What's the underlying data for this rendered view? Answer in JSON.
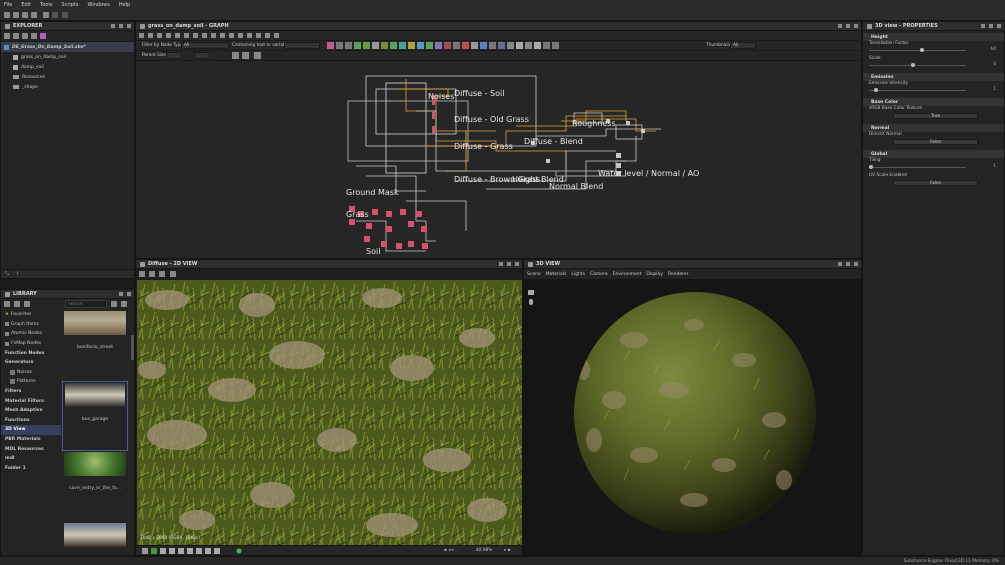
{
  "menu": [
    "File",
    "Edit",
    "Tools",
    "Scripts",
    "Windows",
    "Help"
  ],
  "explorer": {
    "title": "EXPLORER",
    "package": "DE_Grass_On_Damp_Soil.sbs*",
    "items": [
      "grass_on_damp_soil",
      "damp_soil",
      "Resources",
      "_shape"
    ]
  },
  "graph": {
    "title": "grass_on_damp_soil - GRAPH",
    "filter_label": "Filter by Node Type:",
    "filter_value": "All",
    "containing_label": "Containing text or variable:",
    "thumbnails_label": "Thumbnails:",
    "thumbnails_value": "All",
    "parent_size_label": "Parent Size:",
    "frames": [
      "Diffuse - Soil",
      "Noises",
      "Diffuse - Old Grass",
      "Roughness",
      "Diffuse - Grass",
      "Diffuse - Blend",
      "Diffuse - Brown Grass",
      "Height Blend",
      "Normal Blend",
      "Water level / Normal / AO",
      "Ground Mask",
      "Grass",
      "Soil"
    ]
  },
  "properties": {
    "title": "3D view - PROPERTIES",
    "sections": {
      "height": "Height",
      "emission": "Emission",
      "base_color": "Base Color",
      "normal": "Normal",
      "global": "Global"
    },
    "tessellation_label": "Tessellation Factor",
    "tessellation_value": "64",
    "scale_label": "Scale",
    "scale_value": "4",
    "emissive_label": "Emissive Intensity",
    "emissive_value": "1",
    "srgb_label": "sRGB Base Color Texture",
    "srgb_value": "True",
    "directx_label": "DirectX Normal",
    "directx_value": "False",
    "tiling_label": "Tiling",
    "tiling_value": "1",
    "uvscale_label": "UV Scale Enabled",
    "uvscale_value": "False"
  },
  "library": {
    "title": "LIBRARY",
    "search_placeholder": "Search",
    "categories": [
      "Favorites",
      "Graph Items",
      "Atomic Nodes",
      "FxMap Nodes",
      "Function Nodes",
      "Generators",
      "Noises",
      "Patterns",
      "Filters",
      "Material Filters",
      "Mesh Adaptive",
      "Functions",
      "3D View",
      "PBR Materials",
      "MDL Resources",
      "mdl",
      "Folder 1"
    ],
    "thumbs": [
      "bonifacio_street",
      "bus_garage",
      "cave_entry_in_the_fo..."
    ]
  },
  "view2d": {
    "title": "Diffuse - 2D VIEW",
    "info": "2048 x 2048 (RGBA, 16bpc)",
    "zoom": "40.98%"
  },
  "view3d": {
    "title": "3D VIEW",
    "tabs": [
      "Scene",
      "Materials",
      "Lights",
      "Camera",
      "Environment",
      "Display",
      "Renderer"
    ]
  },
  "status": "Substance Engine: Direct3D 11  Memory: 0%"
}
